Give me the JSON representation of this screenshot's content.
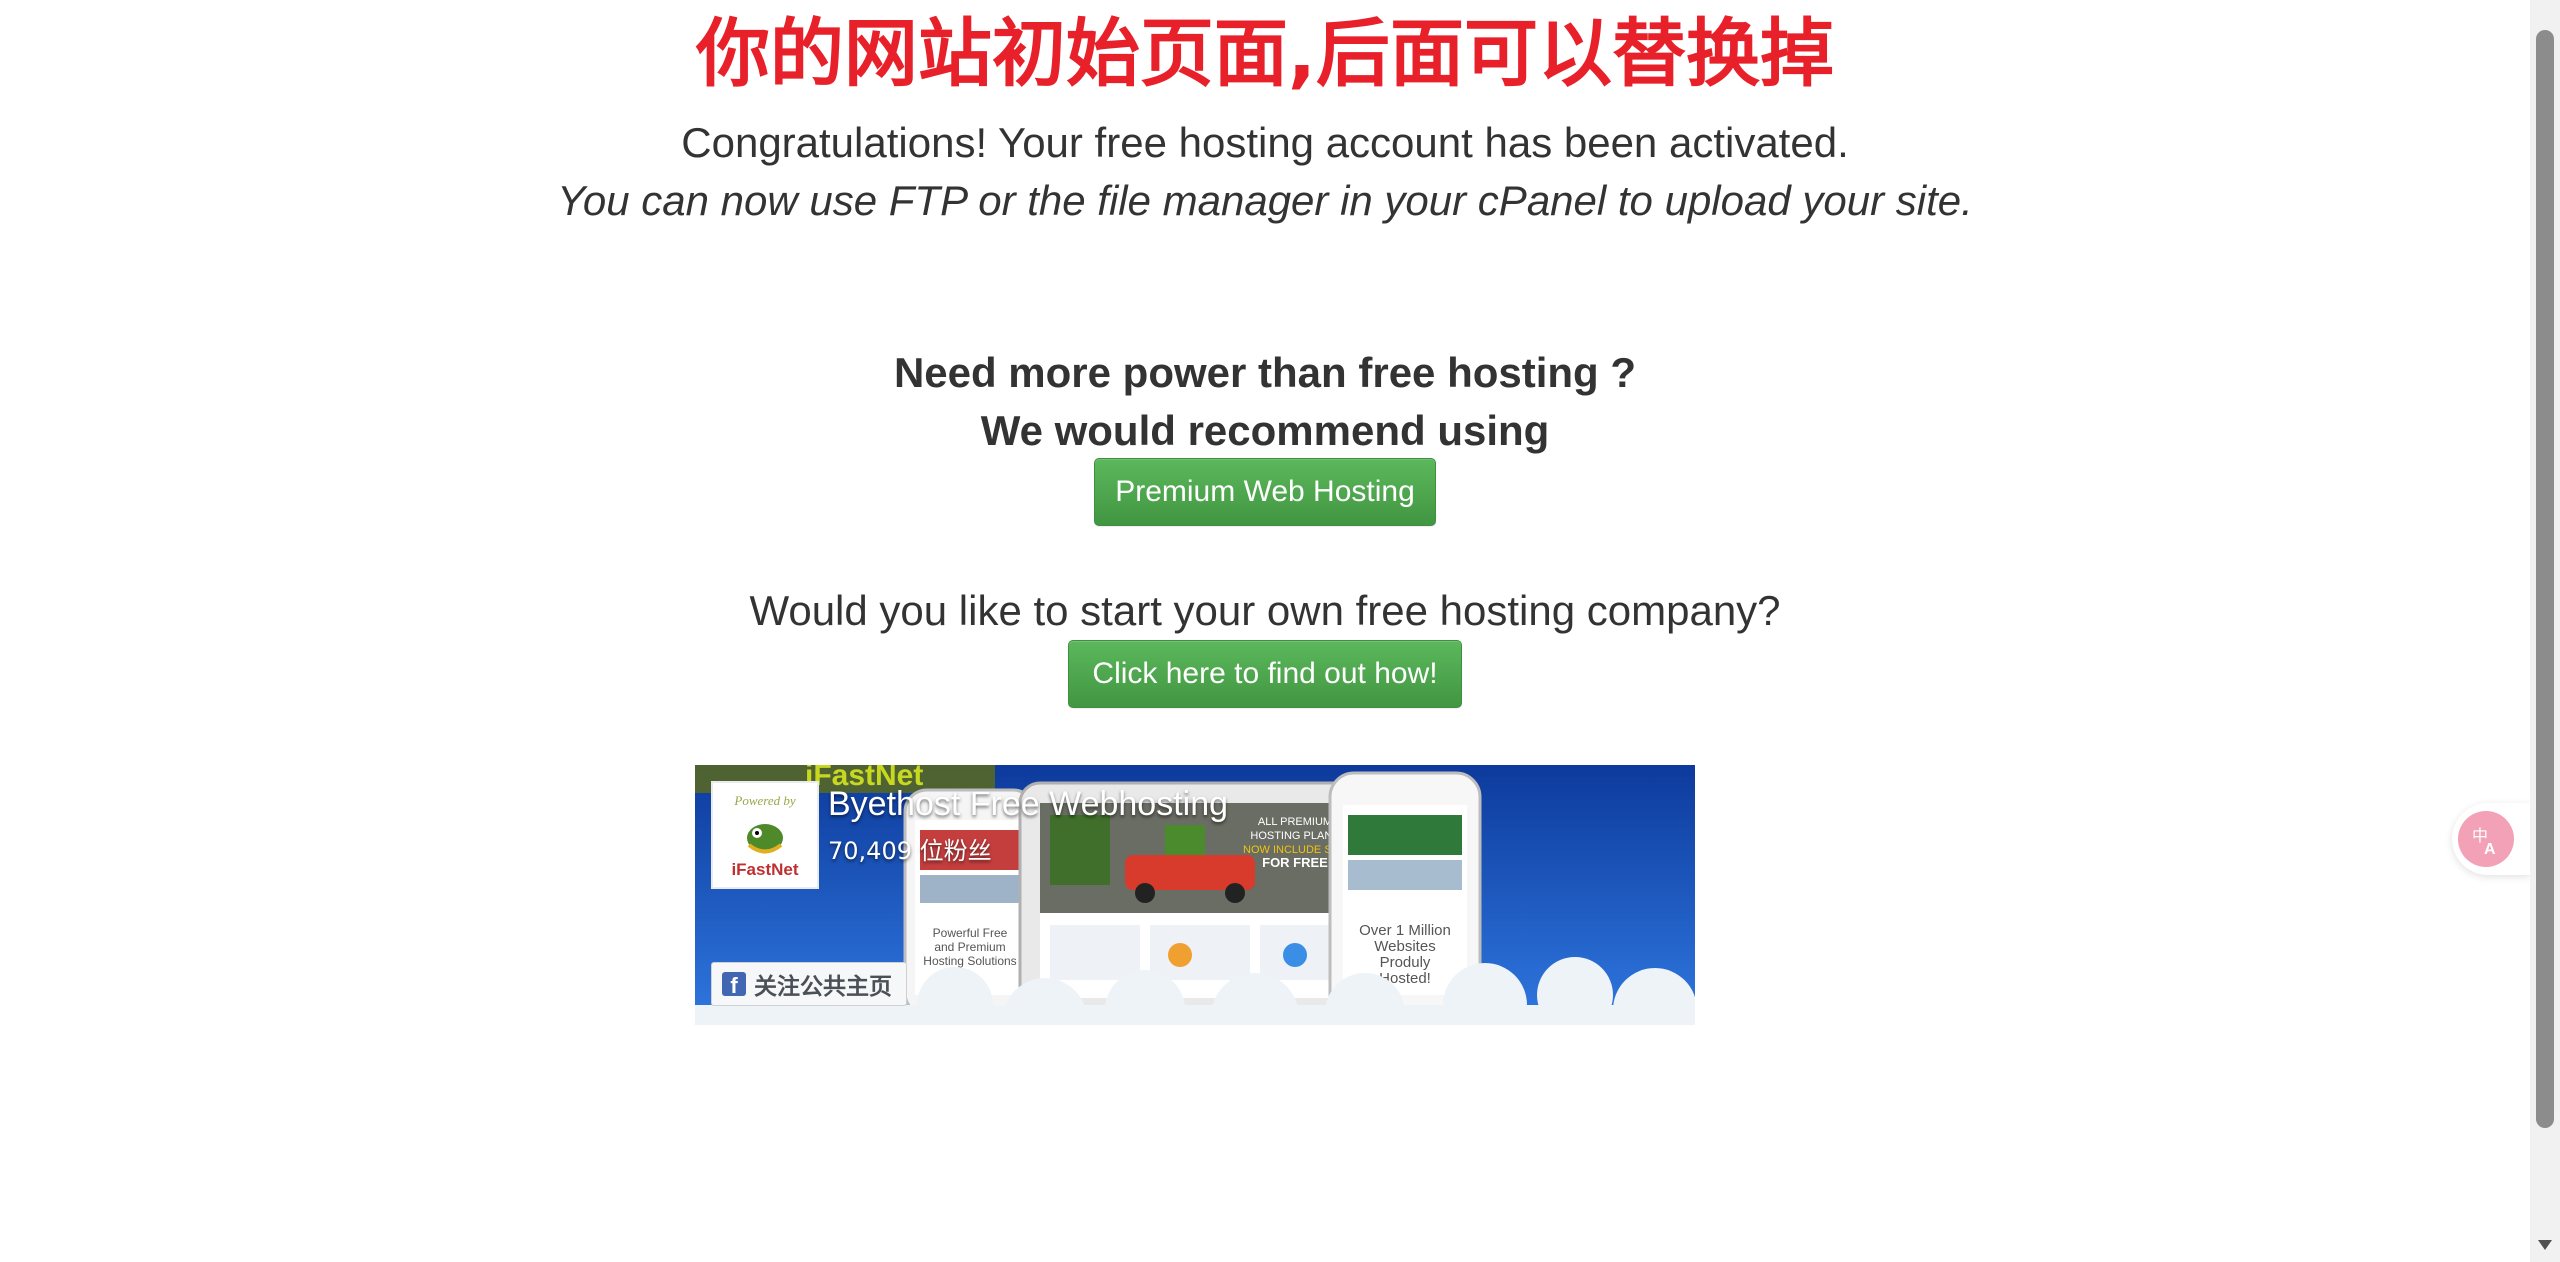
{
  "page": {
    "headline": "你的网站初始页面,后面可以替换掉",
    "congrats_text": "Congratulations! Your free hosting account has been activated.",
    "sub_text": "You can now use FTP or the file manager in your cPanel to upload your site.",
    "power_line1": "Need more power than free hosting ?",
    "power_line2": "We would recommend using",
    "premium_button_label": "Premium Web Hosting",
    "question_text": "Would you like to start your own free hosting company?",
    "howto_button_label": "Click here to find out how!"
  },
  "facebook": {
    "page_name": "Byethost Free Webhosting",
    "follower_count": "70,409 位粉丝",
    "follow_label": "关注公共主页",
    "logo_text_top": "Powered by",
    "logo_text_bottom": "iFastNet",
    "cover_texts": [
      "iFastNet",
      "Powerful Free and Premium Hosting Solutions",
      "Over 1 Million Websites Produly Hosted!",
      "ALL PREMIUM HOSTING PLANS NOW INCLUDE SSD FOR FREE"
    ]
  },
  "colors": {
    "headline": "#e8202a",
    "button_green": "#4cae4c",
    "facebook_blue": "#4267b2",
    "cover_blue": "#1b57c9",
    "translate_pink": "#f2a1b6"
  },
  "icons": {
    "facebook": "facebook-f-icon",
    "translate": "translate-icon",
    "scroll_up": "arrow-up-icon",
    "scroll_down": "arrow-down-icon"
  }
}
